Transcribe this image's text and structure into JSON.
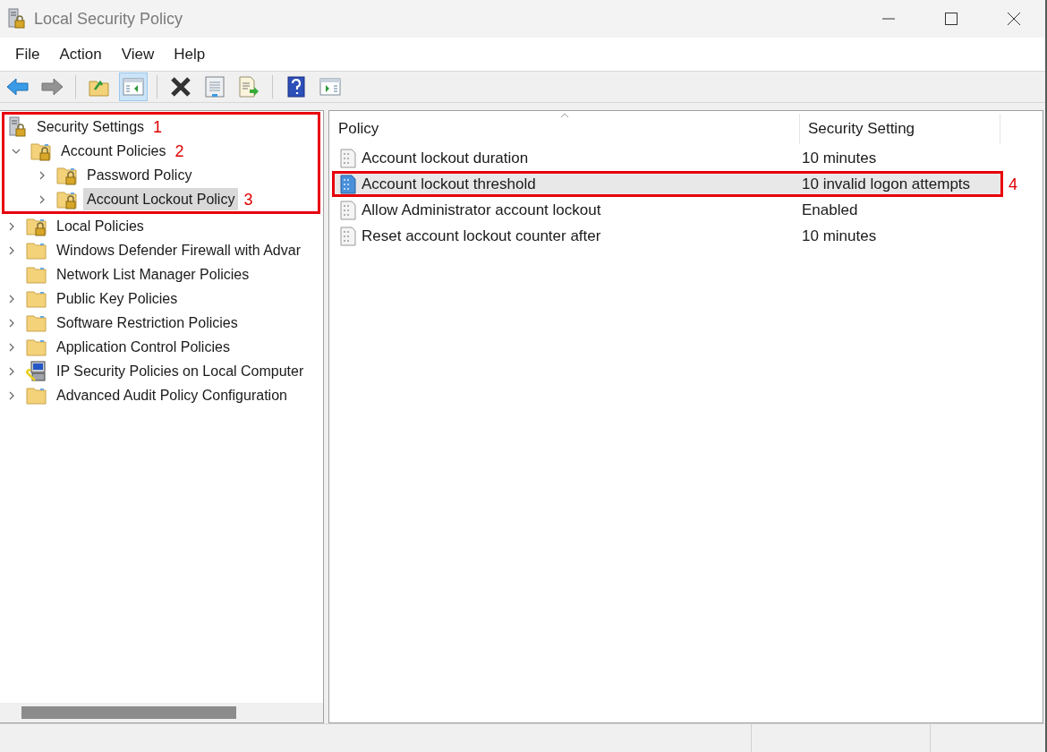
{
  "window": {
    "title": "Local Security Policy"
  },
  "menu": [
    "File",
    "Action",
    "View",
    "Help"
  ],
  "toolbar": [
    {
      "kind": "back",
      "disabled": false
    },
    {
      "kind": "forward",
      "disabled": true
    },
    {
      "kind": "sep"
    },
    {
      "kind": "up-folder",
      "selected": false
    },
    {
      "kind": "show-tree",
      "selected": true
    },
    {
      "kind": "sep"
    },
    {
      "kind": "delete",
      "selected": false
    },
    {
      "kind": "properties",
      "selected": false
    },
    {
      "kind": "export",
      "selected": false
    },
    {
      "kind": "sep"
    },
    {
      "kind": "help",
      "selected": false
    },
    {
      "kind": "show-action",
      "selected": false
    }
  ],
  "tree": {
    "label": "Security Settings",
    "kind": "root",
    "callout": "1",
    "children": [
      {
        "label": "Account Policies",
        "kind": "locked-folder",
        "expanded": true,
        "callout": "2",
        "children": [
          {
            "label": "Password Policy",
            "kind": "locked-folder",
            "expanded": false,
            "selected": false
          },
          {
            "label": "Account Lockout Policy",
            "kind": "locked-folder",
            "expanded": false,
            "selected": true,
            "callout": "3"
          }
        ]
      },
      {
        "label": "Local Policies",
        "kind": "locked-folder",
        "expanded": false,
        "selected": false
      },
      {
        "label": "Windows Defender Firewall with Advar",
        "kind": "folder",
        "expanded": false,
        "selected": false
      },
      {
        "label": "Network List Manager Policies",
        "kind": "folder",
        "selected": false
      },
      {
        "label": "Public Key Policies",
        "kind": "folder",
        "expanded": false,
        "selected": false
      },
      {
        "label": "Software Restriction Policies",
        "kind": "folder",
        "expanded": false,
        "selected": false
      },
      {
        "label": "Application Control Policies",
        "kind": "folder",
        "expanded": false,
        "selected": false
      },
      {
        "label": "IP Security Policies on Local Computer",
        "kind": "computer",
        "expanded": false,
        "selected": false
      },
      {
        "label": "Advanced Audit Policy Configuration",
        "kind": "folder",
        "expanded": false,
        "selected": false
      }
    ]
  },
  "table": {
    "columns": [
      "Policy",
      "Security Setting"
    ],
    "rows": [
      {
        "policy": "Account lockout duration",
        "setting": "10 minutes",
        "selected": false
      },
      {
        "policy": "Account lockout threshold",
        "setting": "10 invalid logon attempts",
        "selected": true,
        "callout": "4"
      },
      {
        "policy": "Allow Administrator account lockout",
        "setting": "Enabled",
        "selected": false
      },
      {
        "policy": "Reset account lockout counter after",
        "setting": "10 minutes",
        "selected": false
      }
    ]
  }
}
